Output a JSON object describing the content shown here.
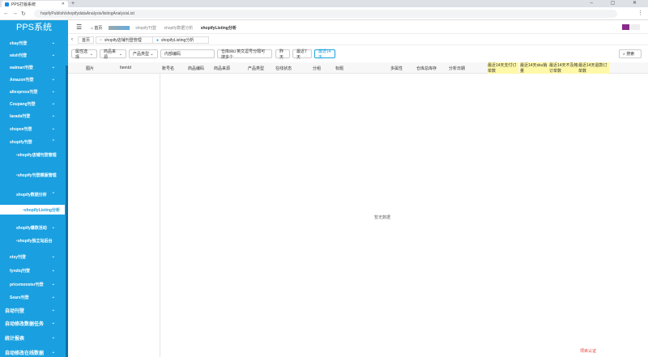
{
  "browser": {
    "tab_title": "PPS打版系统",
    "url": "hopifyPublish/shopifydataAnalysis/listingAnalysisList"
  },
  "app": {
    "logo": "PPS系统"
  },
  "sidebar": {
    "items": [
      {
        "label": "ebay刊登",
        "chev": "⌄"
      },
      {
        "label": "wish刊登",
        "chev": "⌄"
      },
      {
        "label": "walmart刊登",
        "chev": "⌄"
      },
      {
        "label": "Amazon刊登",
        "chev": "⌄"
      },
      {
        "label": "aliexpress刊登",
        "chev": "⌄"
      },
      {
        "label": "Coupang刊登",
        "chev": "⌄"
      },
      {
        "label": "lazada刊登",
        "chev": "⌄"
      },
      {
        "label": "shopee刊登",
        "chev": "⌄"
      },
      {
        "label": "shopify刊登",
        "chev": "⌃"
      },
      {
        "label": "shopify店铺刊登管理"
      },
      {
        "label": "shopify刊登模版管理"
      },
      {
        "label": "shopify数据分析",
        "chev": "⌃"
      },
      {
        "label": "shopifyListing分析",
        "active": true
      },
      {
        "label": "shopify爆款活动",
        "chev": "⌄"
      },
      {
        "label": "shopify独立站后台"
      },
      {
        "label": "etsy刊登",
        "chev": "⌄"
      },
      {
        "label": "fyndiq刊登",
        "chev": "⌄"
      },
      {
        "label": "pricemonster刊登",
        "chev": "⌄"
      },
      {
        "label": "Sears刊登",
        "chev": "⌄"
      },
      {
        "label": "自动刊登",
        "chev": "⌄"
      },
      {
        "label": "自动修改数据任务",
        "chev": "⌄"
      },
      {
        "label": "统计报表",
        "chev": "⌄"
      },
      {
        "label": "自动修改在线数据",
        "chev": "⌄"
      }
    ]
  },
  "breadcrumb": {
    "home": "首页",
    "c1": "shopify刊登",
    "c2": "shopify数据分析",
    "c3": "shopifyListing分析"
  },
  "tabs": [
    {
      "label": "首页"
    },
    {
      "label": "shopify店铺刊登管理"
    },
    {
      "label": "shopifyListing分析"
    }
  ],
  "filters": {
    "f1": "属性选择",
    "f2": "商品来源",
    "f3": "产品类型",
    "f4": "内部编码",
    "f5": "仓库sku 英文逗号分隔可搜多个",
    "d1": "昨天",
    "d2": "最近7天",
    "d3": "最近14天",
    "search": "搜索"
  },
  "table": {
    "headers": [
      "图片",
      "ItemId",
      "账号名",
      "商品编码",
      "商品来源",
      "产品类型",
      "在线状态",
      "分组",
      "标题",
      "多属性",
      "仓库总库存",
      "分析日期",
      "最近14天支付订单数",
      "最近14天sku销量",
      "最近14天不及格订单数",
      "最近14天退款订单数"
    ],
    "empty": "暂无数据"
  },
  "footer": {
    "cert": "项目认证"
  },
  "colors": {
    "sidebar": "#1aa0e0",
    "highlight": "#fff8a8"
  }
}
